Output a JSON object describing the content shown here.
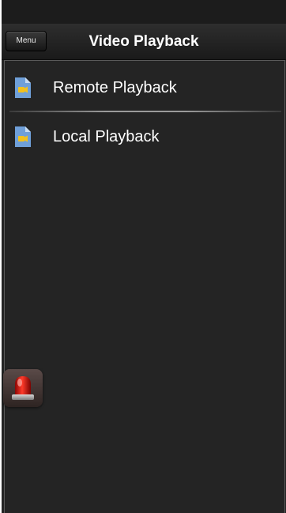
{
  "nav": {
    "menu_label": "Menu",
    "title": "Video Playback"
  },
  "list": {
    "items": [
      {
        "label": "Remote Playback",
        "icon": "video-file-icon"
      },
      {
        "label": "Local Playback",
        "icon": "video-file-icon"
      }
    ]
  },
  "alarm": {
    "icon": "siren-icon"
  },
  "colors": {
    "background": "#242424",
    "icon_blue": "#6f9fd8",
    "icon_yellow": "#f2c11d",
    "siren_red": "#d8100c"
  }
}
